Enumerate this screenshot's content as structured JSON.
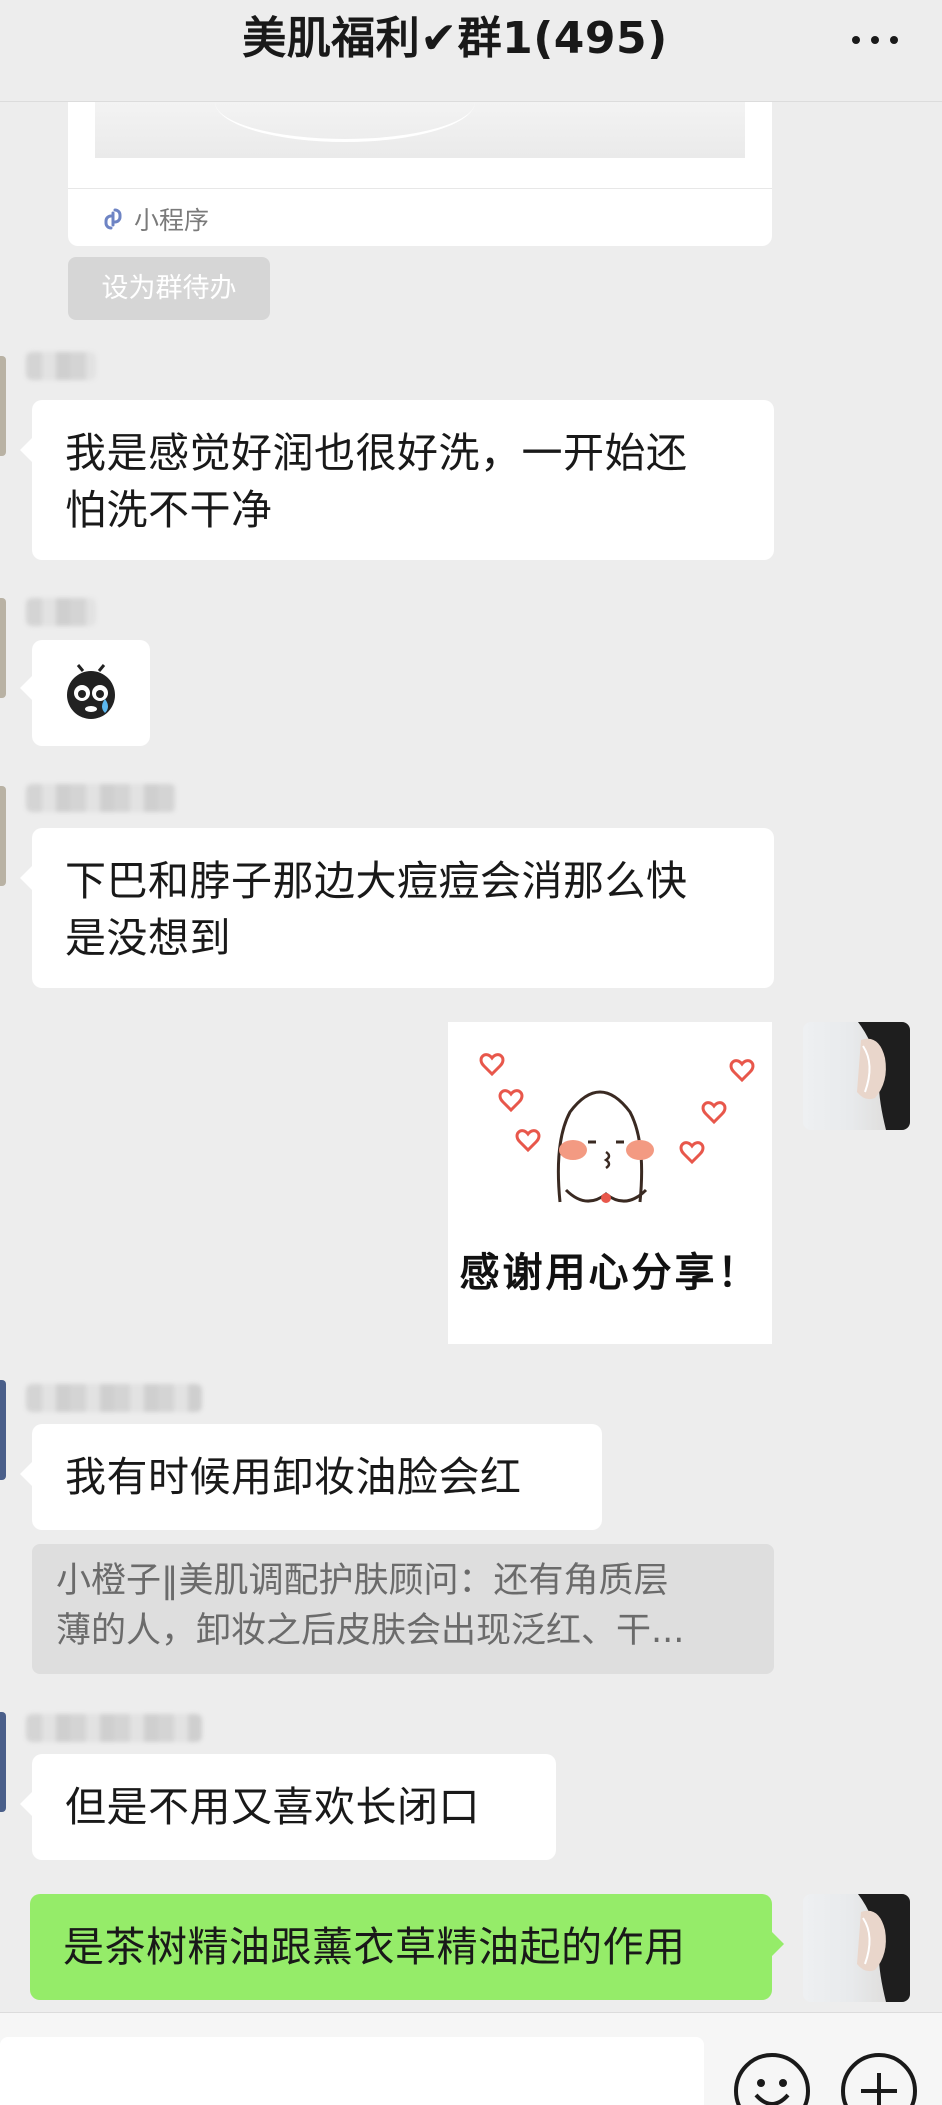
{
  "header": {
    "title": "美肌福利✔群1(495)",
    "more_icon": "more-dots-icon"
  },
  "mini_program_card": {
    "label": "小程序",
    "icon": "link-icon"
  },
  "group_todo_label": "设为群待办",
  "messages": [
    {
      "side": "left",
      "type": "text",
      "text_lines": [
        "我是感觉好润也很好洗，一开始还",
        "怕洗不干净"
      ]
    },
    {
      "side": "left",
      "type": "emoji",
      "icon": "crying-emoji-icon"
    },
    {
      "side": "left",
      "type": "text",
      "text_lines": [
        "下巴和脖子那边大痘痘会消那么快",
        "是没想到"
      ]
    },
    {
      "side": "right",
      "type": "sticker",
      "caption": "感谢用心分享！"
    },
    {
      "side": "left",
      "type": "text",
      "text": "我有时候用卸妆油脸会红",
      "quote_lines": [
        "小橙子‖美肌调配护肤顾问：还有角质层",
        "薄的人，卸妆之后皮肤会出现泛红、干..."
      ]
    },
    {
      "side": "left",
      "type": "text",
      "text": "但是不用又喜欢长闭口"
    },
    {
      "side": "right",
      "type": "text",
      "text": "是茶树精油跟薰衣草精油起的作用"
    }
  ],
  "input_bar": {
    "emoji_icon": "emoji-smile-icon",
    "plus_icon": "plus-icon"
  },
  "colors": {
    "background": "#ededed",
    "bubble_self": "#95ec69",
    "bubble_other": "#ffffff"
  }
}
